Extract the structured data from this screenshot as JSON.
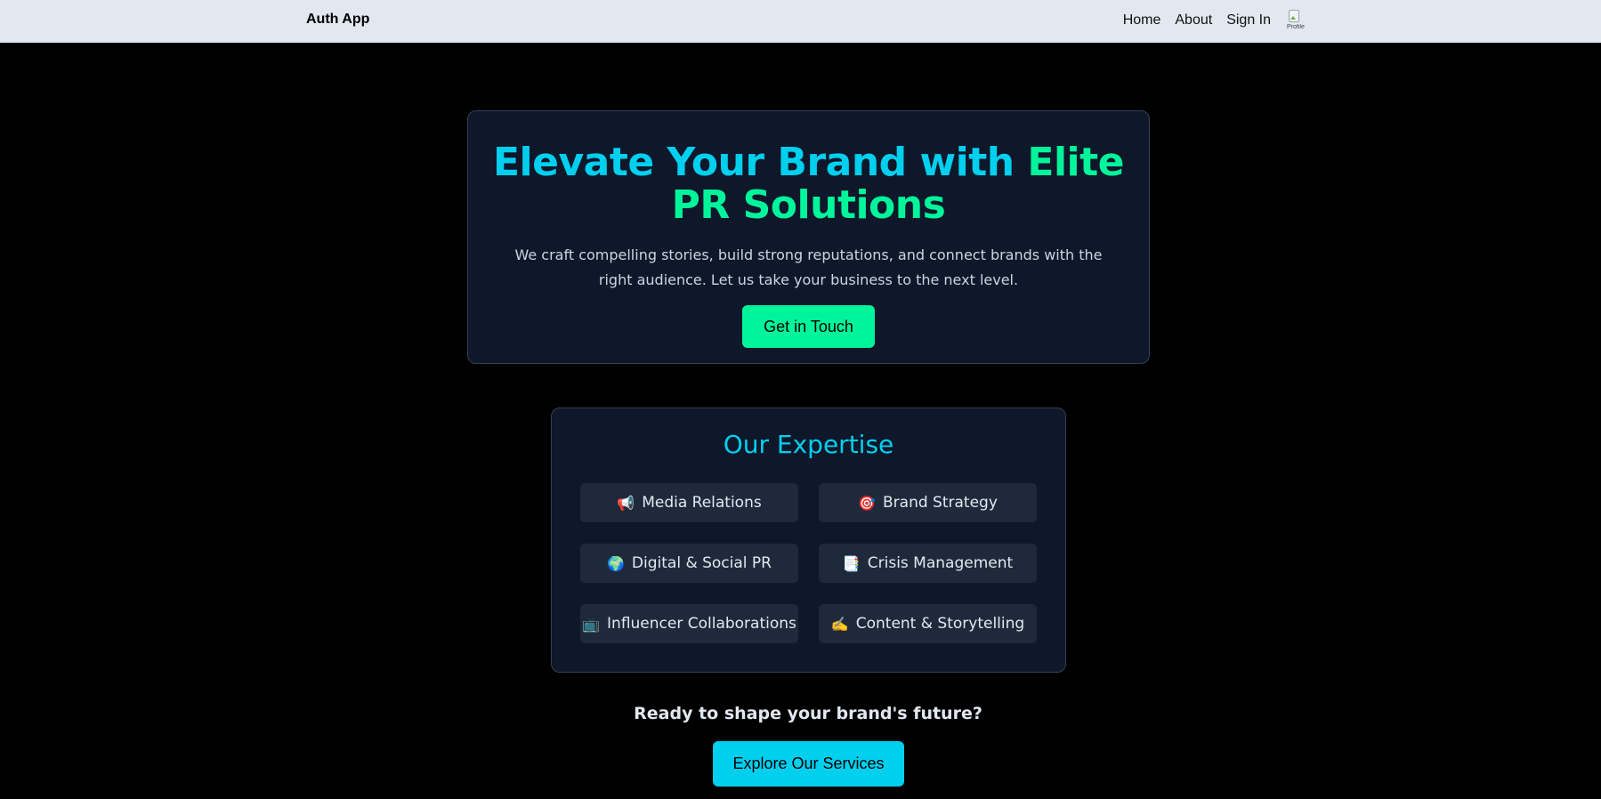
{
  "navbar": {
    "brand": "Auth App",
    "links": [
      "Home",
      "About",
      "Sign In"
    ],
    "avatar_alt": "Profile"
  },
  "hero": {
    "title_part1": "Elevate Your Brand with ",
    "title_part2": "Elite PR Solutions",
    "subtitle": "We craft compelling stories, build strong reputations, and connect brands with the right audience. Let us take your business to the next level.",
    "cta_label": "Get in Touch"
  },
  "expertise": {
    "title": "Our Expertise",
    "items": [
      {
        "icon": "📢",
        "label": "Media Relations"
      },
      {
        "icon": "🎯",
        "label": "Brand Strategy"
      },
      {
        "icon": "🌍",
        "label": "Digital & Social PR"
      },
      {
        "icon": "📑",
        "label": "Crisis Management"
      },
      {
        "icon": "📺",
        "label": "Influencer Collaborations"
      },
      {
        "icon": "✍️",
        "label": "Content & Storytelling"
      }
    ]
  },
  "footer_cta": {
    "prompt": "Ready to shape your brand's future?",
    "button_label": "Explore Our Services"
  },
  "colors": {
    "accent_cyan": "#00cfee",
    "accent_green": "#00f59b",
    "card_bg": "#0f172a",
    "navbar_bg": "#e2e8f0"
  }
}
